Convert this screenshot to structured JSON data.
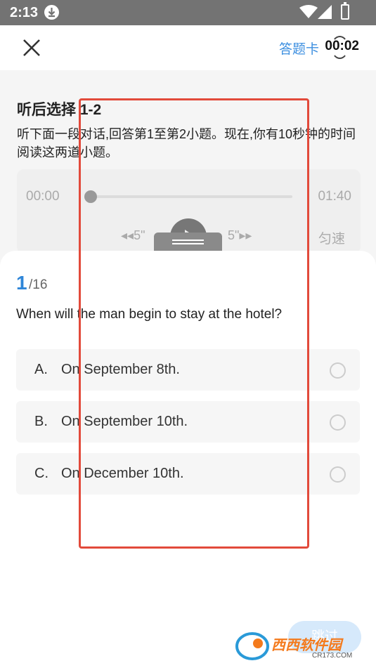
{
  "status_bar": {
    "time": "2:13"
  },
  "header": {
    "answer_card": "答题卡",
    "timer": "00:02"
  },
  "passage": {
    "title": "听后选择 1-2",
    "instruction": "听下面一段对话,回答第1至第2小题。现在,你有10秒钟的时间阅读这两道小题。"
  },
  "player": {
    "time_start": "00:00",
    "time_end": "01:40",
    "progress_fraction": 0,
    "rewind_label": "◂◂5\"",
    "forward_label": "5\"▸▸",
    "speed_label": "匀速"
  },
  "question": {
    "number": "1",
    "total": "/16",
    "text": "When will the man begin to stay at the hotel?",
    "options": [
      {
        "letter": "A.",
        "text": "On September 8th."
      },
      {
        "letter": "B.",
        "text": "On September 10th."
      },
      {
        "letter": "C.",
        "text": "On December 10th."
      }
    ],
    "skip_label": "跳过"
  },
  "watermark": {
    "logo": "西西软件园",
    "site": "CR173.COM"
  },
  "colors": {
    "accent": "#2f86d8",
    "annotation": "#e24a3b"
  }
}
